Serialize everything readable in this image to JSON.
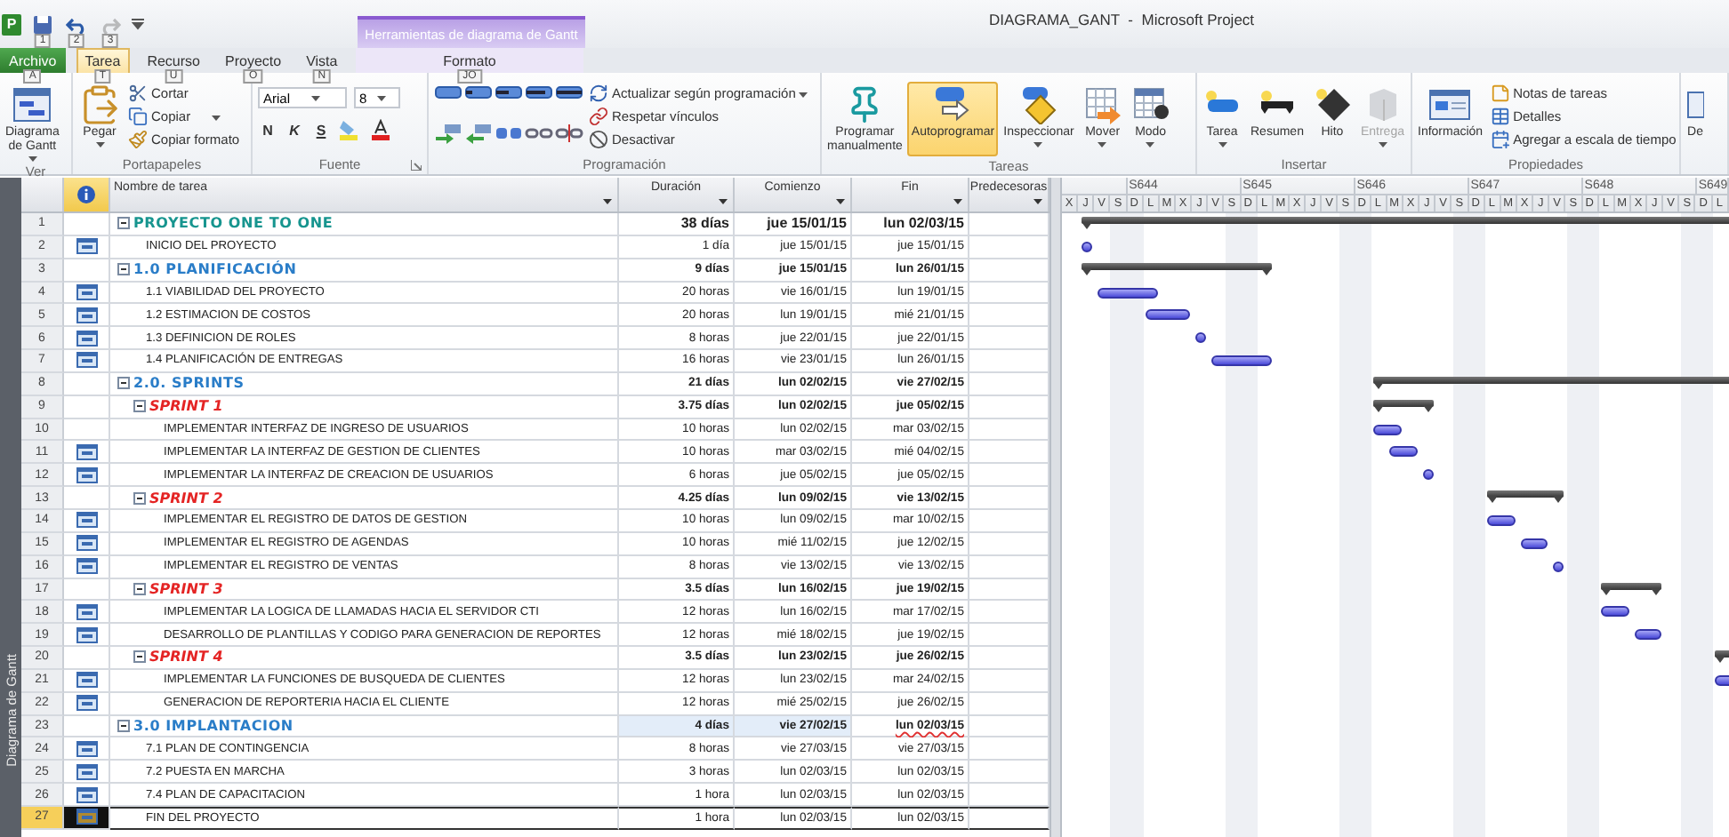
{
  "app_logo": "P",
  "quick_access": [
    {
      "keytip": "1",
      "disabled": false
    },
    {
      "keytip": "2",
      "disabled": false
    },
    {
      "keytip": "3",
      "disabled": true
    }
  ],
  "context_tab_group": "Herramientas de diagrama de Gantt",
  "title": "DIAGRAMA_GANT  -  Microsoft Project",
  "tabs": [
    {
      "label": "Archivo",
      "keytip": "A",
      "kind": "file",
      "selected": false
    },
    {
      "label": "Tarea",
      "keytip": "T",
      "kind": "normal",
      "selected": true
    },
    {
      "label": "Recurso",
      "keytip": "U",
      "kind": "normal",
      "selected": false
    },
    {
      "label": "Proyecto",
      "keytip": "O",
      "kind": "normal",
      "selected": false
    },
    {
      "label": "Vista",
      "keytip": "N",
      "kind": "normal",
      "selected": false
    },
    {
      "label": "Formato",
      "keytip": "JO",
      "kind": "contextual",
      "selected": false
    }
  ],
  "ribbon": [
    {
      "label": "Ver",
      "columns": [
        {
          "kind": "large",
          "label": "Diagrama\nde Gantt",
          "dropdown": true
        }
      ]
    },
    {
      "label": "Portapapeles",
      "columns": [
        {
          "kind": "large",
          "label": "Pegar",
          "dropdown": true
        },
        {
          "kind": "stack",
          "items": [
            {
              "label": "Cortar"
            },
            {
              "label": "Copiar",
              "dropdown": true
            },
            {
              "label": "Copiar formato"
            }
          ]
        }
      ]
    },
    {
      "label": "Fuente",
      "launcher": true,
      "columns": [
        {
          "kind": "font",
          "font": "Arial",
          "size": "8",
          "styles": [
            "N",
            "K",
            "S"
          ]
        }
      ]
    },
    {
      "label": "Programación",
      "columns": [
        {
          "kind": "icon-grid"
        },
        {
          "kind": "stack",
          "items": [
            {
              "label": "Actualizar según programación",
              "dropdown": true
            },
            {
              "label": "Respetar vínculos"
            },
            {
              "label": "Desactivar"
            }
          ]
        }
      ]
    },
    {
      "label": "Tareas",
      "columns": [
        {
          "kind": "large",
          "label": "Programar\nmanualmente",
          "selected": false
        },
        {
          "kind": "large",
          "label": "Autoprogramar",
          "selected": true
        },
        {
          "kind": "large",
          "label": "Inspeccionar",
          "dropdown": true
        },
        {
          "kind": "large",
          "label": "Mover",
          "dropdown": true
        },
        {
          "kind": "large",
          "label": "Modo",
          "dropdown": true
        }
      ]
    },
    {
      "label": "Insertar",
      "columns": [
        {
          "kind": "large",
          "label": "Tarea",
          "dropdown": true,
          "disabled": false
        },
        {
          "kind": "large",
          "label": "Resumen",
          "disabled": false
        },
        {
          "kind": "large",
          "label": "Hito",
          "disabled": false
        },
        {
          "kind": "large",
          "label": "Entrega",
          "dropdown": true,
          "disabled": true
        }
      ]
    },
    {
      "label": "Propiedades",
      "columns": [
        {
          "kind": "large",
          "label": "Información"
        },
        {
          "kind": "stack",
          "items": [
            {
              "label": "Notas de tareas"
            },
            {
              "label": "Detalles"
            },
            {
              "label": "Agregar a escala de tiempo"
            }
          ]
        }
      ]
    },
    {
      "columns": [
        {
          "kind": "large",
          "label": "De"
        }
      ]
    }
  ],
  "view_bar": "Diagrama de Gantt",
  "grid": {
    "columns": [
      "Nombre de tarea",
      "Duración",
      "Comienzo",
      "Fin",
      "Predecesoras"
    ],
    "rows": [
      {
        "id": "1",
        "name": "PROYECTO ONE TO ONE",
        "duration": "38 días",
        "start": "jue 15/01/15",
        "finish": "lun 02/03/15",
        "kind": "project",
        "expanded": true,
        "indicator": false,
        "selected": false,
        "changed": false,
        "children": [
          {
            "id": "2",
            "name": "INICIO DEL PROYECTO",
            "duration": "1 día",
            "start": "jue 15/01/15",
            "finish": "jue 15/01/15",
            "kind": "task",
            "indicator": true,
            "selected": false,
            "changed": false
          },
          {
            "id": "3",
            "name": "1.0 PLANIFICACIÓN",
            "duration": "9 días",
            "start": "jue 15/01/15",
            "finish": "lun 26/01/15",
            "kind": "phase",
            "expanded": true,
            "indicator": false,
            "selected": false,
            "changed": false,
            "children": [
              {
                "id": "4",
                "name": "1.1 VIABILIDAD DEL PROYECTO",
                "duration": "20 horas",
                "start": "vie 16/01/15",
                "finish": "lun 19/01/15",
                "kind": "task",
                "indicator": true,
                "selected": false,
                "changed": false
              },
              {
                "id": "5",
                "name": "1.2 ESTIMACION DE COSTOS",
                "duration": "20 horas",
                "start": "lun 19/01/15",
                "finish": "mié 21/01/15",
                "kind": "task",
                "indicator": true,
                "selected": false,
                "changed": false
              },
              {
                "id": "6",
                "name": "1.3 DEFINICION DE ROLES",
                "duration": "8 horas",
                "start": "jue 22/01/15",
                "finish": "jue 22/01/15",
                "kind": "task",
                "indicator": true,
                "selected": false,
                "changed": false
              },
              {
                "id": "7",
                "name": "1.4 PLANIFICACIÓN DE ENTREGAS",
                "duration": "16 horas",
                "start": "vie 23/01/15",
                "finish": "lun 26/01/15",
                "kind": "task",
                "indicator": true,
                "selected": false,
                "changed": false
              }
            ]
          },
          {
            "id": "8",
            "name": "2.0. SPRINTS",
            "duration": "21 días",
            "start": "lun 02/02/15",
            "finish": "vie 27/02/15",
            "kind": "phase",
            "expanded": true,
            "indicator": false,
            "selected": false,
            "changed": false,
            "children": [
              {
                "id": "9",
                "name": "SPRINT 1",
                "duration": "3.75 días",
                "start": "lun 02/02/15",
                "finish": "jue 05/02/15",
                "kind": "sprint",
                "expanded": true,
                "indicator": false,
                "selected": false,
                "changed": false,
                "children": [
                  {
                    "id": "10",
                    "name": "IMPLEMENTAR INTERFAZ DE INGRESO DE USUARIOS",
                    "duration": "10 horas",
                    "start": "lun 02/02/15",
                    "finish": "mar 03/02/15",
                    "kind": "task",
                    "indicator": false,
                    "selected": false,
                    "changed": false
                  },
                  {
                    "id": "11",
                    "name": "IMPLEMENTAR LA INTERFAZ DE GESTION DE CLIENTES",
                    "duration": "10 horas",
                    "start": "mar 03/02/15",
                    "finish": "mié 04/02/15",
                    "kind": "task",
                    "indicator": true,
                    "selected": false,
                    "changed": false
                  },
                  {
                    "id": "12",
                    "name": "IMPLEMENTAR LA INTERFAZ DE CREACION DE USUARIOS",
                    "duration": "6 horas",
                    "start": "jue 05/02/15",
                    "finish": "jue 05/02/15",
                    "kind": "task",
                    "indicator": true,
                    "selected": false,
                    "changed": false
                  }
                ]
              },
              {
                "id": "13",
                "name": "SPRINT 2",
                "duration": "4.25 días",
                "start": "lun 09/02/15",
                "finish": "vie 13/02/15",
                "kind": "sprint",
                "expanded": true,
                "indicator": false,
                "selected": false,
                "changed": false,
                "children": [
                  {
                    "id": "14",
                    "name": "IMPLEMENTAR EL REGISTRO DE DATOS DE GESTION",
                    "duration": "10 horas",
                    "start": "lun 09/02/15",
                    "finish": "mar 10/02/15",
                    "kind": "task",
                    "indicator": true,
                    "selected": false,
                    "changed": false
                  },
                  {
                    "id": "15",
                    "name": "IMPLEMENTAR EL REGISTRO DE AGENDAS",
                    "duration": "10 horas",
                    "start": "mié 11/02/15",
                    "finish": "jue 12/02/15",
                    "kind": "task",
                    "indicator": true,
                    "selected": false,
                    "changed": false
                  },
                  {
                    "id": "16",
                    "name": "IMPLEMENTAR EL REGISTRO DE VENTAS",
                    "duration": "8 horas",
                    "start": "vie 13/02/15",
                    "finish": "vie 13/02/15",
                    "kind": "task",
                    "indicator": true,
                    "selected": false,
                    "changed": false
                  }
                ]
              },
              {
                "id": "17",
                "name": "SPRINT 3",
                "duration": "3.5 días",
                "start": "lun 16/02/15",
                "finish": "jue 19/02/15",
                "kind": "sprint",
                "expanded": true,
                "indicator": false,
                "selected": false,
                "changed": false,
                "children": [
                  {
                    "id": "18",
                    "name": "IMPLEMENTAR LA LOGICA DE LLAMADAS HACIA EL SERVIDOR CTI",
                    "duration": "12 horas",
                    "start": "lun 16/02/15",
                    "finish": "mar 17/02/15",
                    "kind": "task",
                    "indicator": true,
                    "selected": false,
                    "changed": false
                  },
                  {
                    "id": "19",
                    "name": "DESARROLLO DE PLANTILLAS Y CODIGO PARA GENERACION DE REPORTES",
                    "duration": "12 horas",
                    "start": "mié 18/02/15",
                    "finish": "jue 19/02/15",
                    "kind": "task",
                    "indicator": true,
                    "selected": false,
                    "changed": false
                  }
                ]
              },
              {
                "id": "20",
                "name": "SPRINT 4",
                "duration": "3.5 días",
                "start": "lun 23/02/15",
                "finish": "jue 26/02/15",
                "kind": "sprint",
                "expanded": true,
                "indicator": false,
                "selected": false,
                "changed": false,
                "children": [
                  {
                    "id": "21",
                    "name": "IMPLEMENTAR LA FUNCIONES DE BUSQUEDA DE CLIENTES",
                    "duration": "12 horas",
                    "start": "lun 23/02/15",
                    "finish": "mar 24/02/15",
                    "kind": "task",
                    "indicator": true,
                    "selected": false,
                    "changed": false
                  },
                  {
                    "id": "22",
                    "name": "GENERACION DE REPORTERIA HACIA EL CLIENTE",
                    "duration": "12 horas",
                    "start": "mié 25/02/15",
                    "finish": "jue 26/02/15",
                    "kind": "task",
                    "indicator": true,
                    "selected": false,
                    "changed": false
                  }
                ]
              }
            ]
          },
          {
            "id": "23",
            "name": "3.0 IMPLANTACION",
            "duration": "4 días",
            "start": "vie 27/02/15",
            "finish": "lun 02/03/15",
            "kind": "phase",
            "expanded": true,
            "indicator": false,
            "selected": false,
            "changed": true,
            "children": [
              {
                "id": "24",
                "name": "7.1 PLAN DE CONTINGENCIA",
                "duration": "8 horas",
                "start": "vie 27/03/15",
                "finish": "vie 27/03/15",
                "kind": "task",
                "indicator": true,
                "selected": false,
                "changed": false
              },
              {
                "id": "25",
                "name": "7.2 PUESTA EN MARCHA",
                "duration": "3 horas",
                "start": "lun 02/03/15",
                "finish": "lun 02/03/15",
                "kind": "task",
                "indicator": true,
                "selected": false,
                "changed": false
              },
              {
                "id": "26",
                "name": "7.4 PLAN DE CAPACITACION",
                "duration": "1 hora",
                "start": "lun 02/03/15",
                "finish": "lun 02/03/15",
                "kind": "task",
                "indicator": true,
                "selected": false,
                "changed": false
              }
            ]
          },
          {
            "id": "27",
            "name": "FIN DEL PROYECTO",
            "duration": "1 hora",
            "start": "lun 02/03/15",
            "finish": "lun 02/03/15",
            "kind": "task",
            "indicator": true,
            "selected": true,
            "changed": false
          }
        ]
      }
    ]
  },
  "timescale": {
    "leading_days": [
      "X",
      "J",
      "V",
      "S"
    ],
    "weeks": [
      {
        "label": "S644",
        "days": [
          "D",
          "L",
          "M",
          "X",
          "J",
          "V",
          "S"
        ]
      },
      {
        "label": "S645",
        "days": [
          "D",
          "L",
          "M",
          "X",
          "J",
          "V",
          "S"
        ]
      },
      {
        "label": "S646",
        "days": [
          "D",
          "L",
          "M",
          "X",
          "J",
          "V",
          "S"
        ]
      },
      {
        "label": "S647",
        "days": [
          "D",
          "L",
          "M",
          "X",
          "J",
          "V",
          "S"
        ]
      },
      {
        "label": "S648",
        "days": [
          "D",
          "L",
          "M",
          "X",
          "J",
          "V",
          "S"
        ]
      },
      {
        "label": "S649",
        "days": [
          "D",
          "L"
        ]
      }
    ]
  }
}
